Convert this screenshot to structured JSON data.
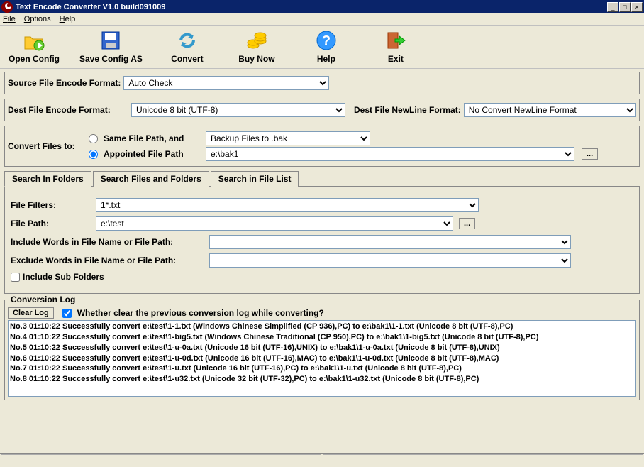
{
  "title": "Text Encode Converter V1.0 build091009",
  "menu": {
    "file": "File",
    "options": "Options",
    "help": "Help"
  },
  "toolbar": {
    "open": "Open Config",
    "save": "Save Config AS",
    "convert": "Convert",
    "buy": "Buy Now",
    "help": "Help",
    "exit": "Exit"
  },
  "source": {
    "label": "Source File Encode Format:",
    "value": "Auto Check"
  },
  "dest": {
    "label": "Dest File Encode Format:",
    "value": "Unicode 8 bit (UTF-8)",
    "newline_label": "Dest File NewLine Format:",
    "newline_value": "No Convert NewLine Format"
  },
  "convert_to": {
    "label": "Convert Files to:",
    "opt_same": "Same File Path, and",
    "opt_appointed": "Appointed File Path",
    "backup_value": "Backup Files to .bak",
    "path_value": "e:\\bak1",
    "browse": "..."
  },
  "tabs": {
    "t1": "Search In Folders",
    "t2": "Search Files and Folders",
    "t3": "Search in File List"
  },
  "search": {
    "filters_label": "File Filters:",
    "filters_value": "1*.txt",
    "path_label": "File Path:",
    "path_value": "e:\\test",
    "browse": "...",
    "include_label": "Include Words in File Name or File Path:",
    "exclude_label": "Exclude Words in File Name or File Path:",
    "sub_label": "Include Sub Folders"
  },
  "log": {
    "legend": "Conversion Log",
    "clear_btn": "Clear Log",
    "check_label": "Whether clear the previous conversion log while converting?",
    "lines": [
      "No.3 01:10:22 Successfully convert e:\\test\\1-1.txt (Windows Chinese Simplified (CP 936),PC) to e:\\bak1\\1-1.txt (Unicode 8 bit (UTF-8),PC)",
      "No.4 01:10:22 Successfully convert e:\\test\\1-big5.txt (Windows Chinese Traditional (CP 950),PC) to e:\\bak1\\1-big5.txt (Unicode 8 bit (UTF-8),PC)",
      "No.5 01:10:22 Successfully convert e:\\test\\1-u-0a.txt (Unicode 16 bit (UTF-16),UNIX) to e:\\bak1\\1-u-0a.txt (Unicode 8 bit (UTF-8),UNIX)",
      "No.6 01:10:22 Successfully convert e:\\test\\1-u-0d.txt (Unicode 16 bit (UTF-16),MAC) to e:\\bak1\\1-u-0d.txt (Unicode 8 bit (UTF-8),MAC)",
      "No.7 01:10:22 Successfully convert e:\\test\\1-u.txt (Unicode 16 bit (UTF-16),PC) to e:\\bak1\\1-u.txt (Unicode 8 bit (UTF-8),PC)",
      "No.8 01:10:22 Successfully convert e:\\test\\1-u32.txt (Unicode 32 bit (UTF-32),PC) to e:\\bak1\\1-u32.txt (Unicode 8 bit (UTF-8),PC)"
    ]
  }
}
